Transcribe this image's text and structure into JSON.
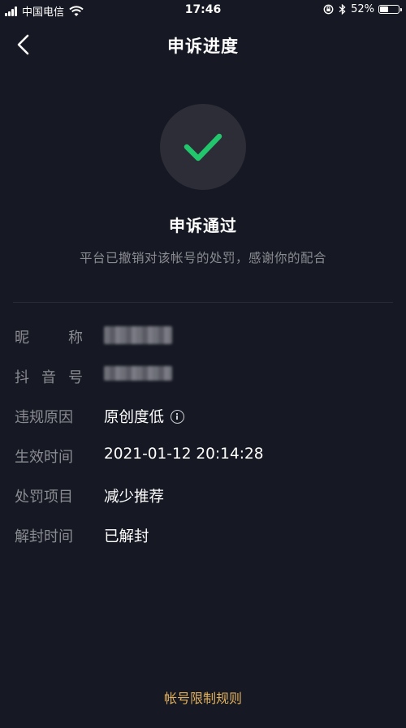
{
  "status_bar": {
    "carrier": "中国电信",
    "time": "17:46",
    "battery_percent": "52%",
    "battery_level": 0.52
  },
  "nav": {
    "title": "申诉进度"
  },
  "result": {
    "title": "申诉通过",
    "description": "平台已撤销对该帐号的处罚，感谢你的配合",
    "icon": "check-icon",
    "accent_color": "#22c66d"
  },
  "info": {
    "nickname_label": [
      "昵",
      "称"
    ],
    "douyin_id_label": [
      "抖",
      "音",
      "号"
    ],
    "violation_reason_label": "违规原因",
    "violation_reason_value": "原创度低",
    "effective_time_label": "生效时间",
    "effective_time_value": "2021-01-12 20:14:28",
    "penalty_label": "处罚项目",
    "penalty_value": "减少推荐",
    "unblock_time_label": "解封时间",
    "unblock_time_value": "已解封"
  },
  "footer": {
    "rules_link": "帐号限制规则",
    "link_color": "#e1b15b"
  }
}
